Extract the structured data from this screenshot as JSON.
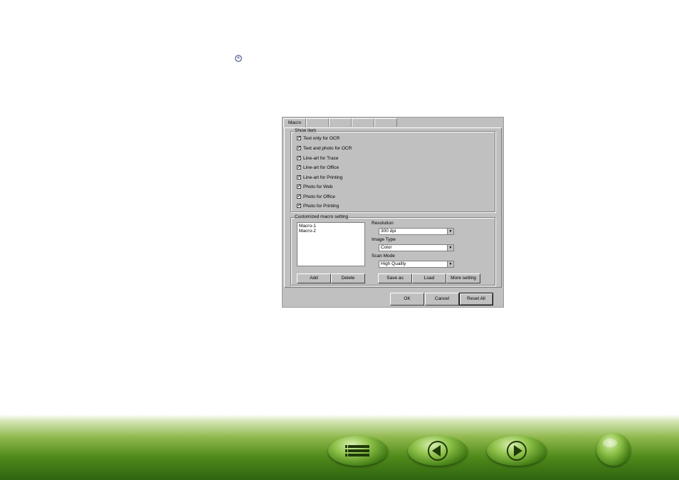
{
  "dialog": {
    "tabs": [
      "Macro",
      "",
      "",
      "",
      "",
      ""
    ],
    "show_item": {
      "title": "Show item",
      "items": [
        {
          "label": "Text only for OCR",
          "checked": true
        },
        {
          "label": "Text and photo for OCR",
          "checked": true
        },
        {
          "label": "Line-art for Trace",
          "checked": true
        },
        {
          "label": "Line-art for Office",
          "checked": true
        },
        {
          "label": "Line-art for Printing",
          "checked": true
        },
        {
          "label": "Photo for Web",
          "checked": true
        },
        {
          "label": "Photo for Office",
          "checked": true
        },
        {
          "label": "Photo for Printing",
          "checked": true
        }
      ]
    },
    "custom": {
      "title": "Customized macro setting",
      "macros": [
        "Macro-1",
        "Macro-2"
      ],
      "resolution_label": "Resolution",
      "resolution_value": "300 dpi",
      "image_type_label": "Image Type",
      "image_type_value": "Color",
      "scan_mode_label": "Scan Mode",
      "scan_mode_value": "High Quality",
      "add": "Add",
      "delete": "Delete",
      "save_as": "Save as",
      "load": "Load",
      "more_setting": "More setting"
    },
    "ok": "OK",
    "cancel": "Cancel",
    "reset_all": "Reset All"
  },
  "icons": {
    "bullet": "asterisk-bullet-icon",
    "nav": [
      "contents-list-icon",
      "previous-arrow-icon",
      "next-arrow-icon",
      "home-icon"
    ]
  },
  "colors": {
    "footer_green": "#4f8a1a",
    "dialog_gray": "#c0c0c0"
  }
}
